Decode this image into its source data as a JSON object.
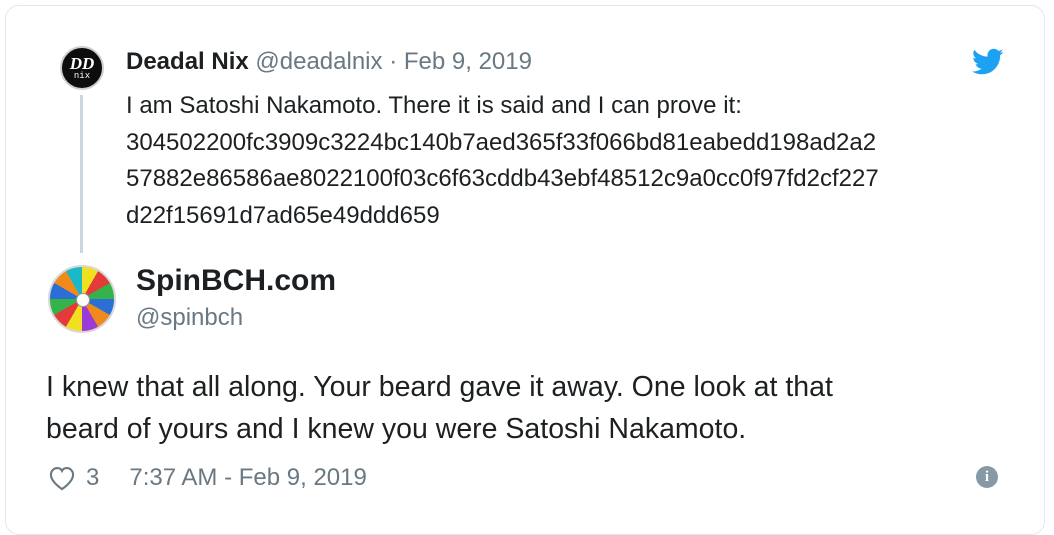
{
  "quoted": {
    "name": "Deadal Nix",
    "handle": "@deadalnix",
    "separator": "·",
    "date": "Feb 9, 2019",
    "avatar_top": "DD",
    "avatar_bottom": "nix",
    "lines": [
      "I am Satoshi Nakamoto. There it is said and I can prove it:",
      "304502200fc3909c3224bc140b7aed365f33f066bd81eabedd198ad2a2",
      "57882e86586ae8022100f03c6f63cddb43ebf48512c9a0cc0f97fd2cf227",
      "d22f15691d7ad65e49ddd659"
    ]
  },
  "main": {
    "name": "SpinBCH.com",
    "handle": "@spinbch",
    "lines": [
      "I knew that all along. Your beard gave it away. One look at that",
      "beard of yours and I knew you were Satoshi Nakamoto."
    ],
    "likes": "3",
    "timestamp": "7:37 AM - Feb 9, 2019"
  },
  "icons": {
    "twitter": "twitter-bird-icon",
    "like": "heart-icon",
    "info": "info-icon"
  },
  "colors": {
    "twitter_blue": "#1da1f2",
    "text": "#1c2022",
    "muted": "#697882",
    "thread_line": "#ccd6dd"
  }
}
